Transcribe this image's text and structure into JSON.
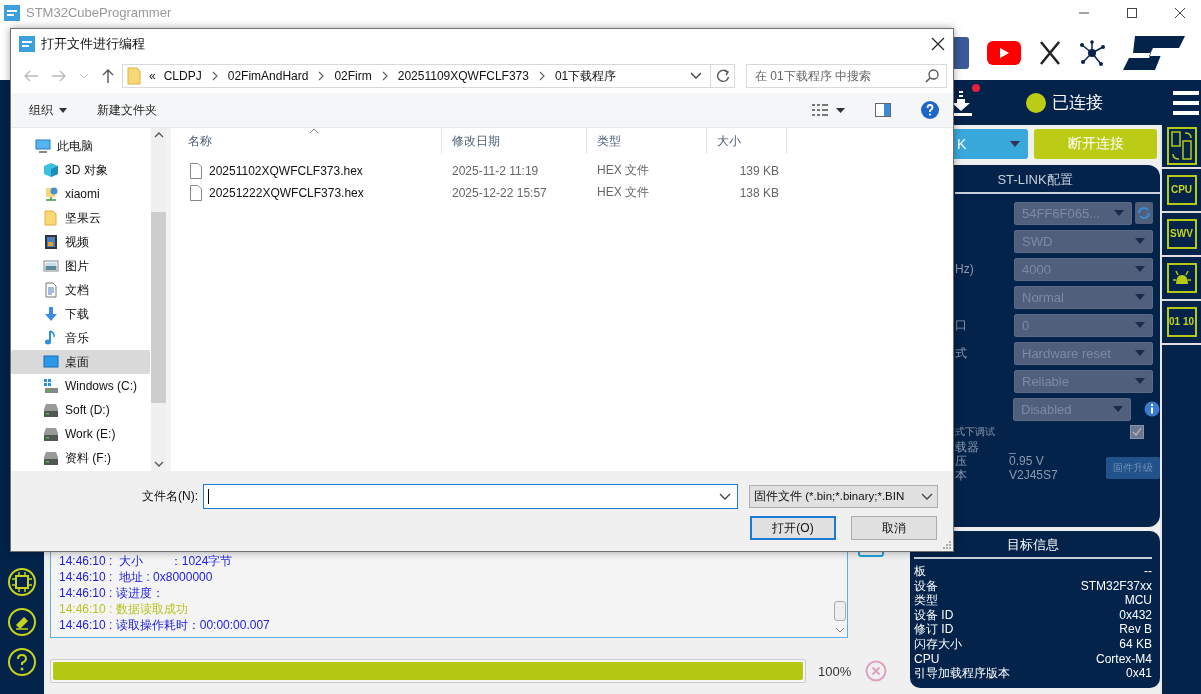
{
  "app": {
    "title": "STM32CubeProgrammer"
  },
  "status": {
    "label": "已连接",
    "connected": true,
    "notification": true
  },
  "connection": {
    "interface": "K",
    "disconnect": "断开连接"
  },
  "stlink_config": {
    "title": "ST-LINK配置",
    "fields": [
      {
        "kind": "select",
        "value": "54FF6F065...",
        "disabled": true,
        "refresh": true
      },
      {
        "kind": "select",
        "value": "SWD",
        "disabled": true
      },
      {
        "kind": "select",
        "label": "Hz)",
        "value": "4000",
        "disabled": true
      },
      {
        "kind": "select",
        "value": "Normal",
        "disabled": true
      },
      {
        "kind": "select",
        "label": "口",
        "value": "0",
        "disabled": true
      },
      {
        "kind": "select",
        "label": "式",
        "value": "Hardware reset",
        "disabled": true
      },
      {
        "kind": "select",
        "value": "Reliable",
        "disabled": true
      },
      {
        "kind": "select",
        "value": "Disabled",
        "disabled": true,
        "info": true
      },
      {
        "kind": "checkbox",
        "label": "式下调试",
        "checked": true,
        "disabled": true
      },
      {
        "kind": "info",
        "label": "载器",
        "value": "_"
      },
      {
        "kind": "info",
        "label": "压",
        "value": "0.95 V"
      },
      {
        "kind": "info",
        "label": "本",
        "value": "V2J45S7"
      }
    ],
    "firmware_button": {
      "label": "固件升级",
      "disabled": true
    }
  },
  "tools": [
    {
      "kind": "files"
    },
    {
      "kind": "text",
      "label": "CPU"
    },
    {
      "kind": "text",
      "label": "SWV"
    },
    {
      "kind": "bug"
    },
    {
      "kind": "text",
      "label": "01 10"
    }
  ],
  "log": [
    {
      "kind": "info",
      "text": "14:46:10 :  大小        ：1024字节"
    },
    {
      "kind": "info",
      "text": "14:46:10 :  地址 : 0x8000000"
    },
    {
      "kind": "info",
      "text": "14:46:10 : 读进度："
    },
    {
      "kind": "success",
      "text": "14:46:10 : 数据读取成功"
    },
    {
      "kind": "info",
      "text": "14:46:10 : 读取操作耗时：00:00:00.007"
    }
  ],
  "progress": {
    "level": 1,
    "reading": "100%"
  },
  "target_info": {
    "title": "目标信息",
    "rows": [
      {
        "label": "板",
        "value": "--"
      },
      {
        "label": "设备",
        "value": "STM32F37xx"
      },
      {
        "label": "类型",
        "value": "MCU"
      },
      {
        "label": "设备 ID",
        "value": "0x432"
      },
      {
        "label": "修订 ID",
        "value": "Rev B"
      },
      {
        "label": "闪存大小",
        "value": "64 KB"
      },
      {
        "label": "CPU",
        "value": "Cortex-M4"
      },
      {
        "label": "引导加载程序版本",
        "value": "0x41"
      }
    ]
  },
  "dialog": {
    "title": "打开文件进行编程",
    "overflow_mark": "«",
    "path": [
      "CLDPJ",
      "02FimAndHard",
      "02Firm",
      "20251109XQWFCLF373",
      "01下载程序"
    ],
    "search": {
      "placeholder": "在 01下载程序 中搜索"
    },
    "toolbar": {
      "organize": "组织",
      "new_folder": "新建文件夹"
    },
    "nav": [
      {
        "label": "此电脑",
        "kind": "computer",
        "selected": false,
        "children": [
          {
            "label": "3D 对象",
            "kind": "cube",
            "selected": false
          },
          {
            "label": "xiaomi",
            "kind": "network",
            "selected": false
          },
          {
            "label": "坚果云",
            "kind": "folder",
            "selected": false
          },
          {
            "label": "视频",
            "kind": "video",
            "selected": false
          },
          {
            "label": "图片",
            "kind": "pictures",
            "selected": false
          },
          {
            "label": "文档",
            "kind": "documents",
            "selected": false
          },
          {
            "label": "下载",
            "kind": "downloads",
            "selected": false
          },
          {
            "label": "音乐",
            "kind": "music",
            "selected": false
          },
          {
            "label": "桌面",
            "kind": "desktop",
            "selected": true
          },
          {
            "label": "Windows (C:)",
            "kind": "system_drive",
            "selected": false
          },
          {
            "label": "Soft (D:)",
            "kind": "drive",
            "selected": false
          },
          {
            "label": "Work (E:)",
            "kind": "drive",
            "selected": false
          },
          {
            "label": "资料 (F:)",
            "kind": "drive",
            "selected": false
          }
        ]
      }
    ],
    "columns": [
      "名称",
      "修改日期",
      "类型",
      "大小"
    ],
    "files": [
      {
        "name": "20251102XQWFCLF373.hex",
        "modified": "2025-11-2 11:19",
        "type": "HEX 文件",
        "size": "139 KB",
        "selected": false
      },
      {
        "name": "20251222XQWFCLF373.hex",
        "modified": "2025-12-22 15:57",
        "type": "HEX 文件",
        "size": "138 KB",
        "selected": false
      }
    ],
    "file_name": {
      "label": "文件名(N):"
    },
    "filter": "固件文件 (*.bin;*.binary;*.BIN",
    "buttons": [
      {
        "label": "打开(O)",
        "default": true
      },
      {
        "label": "取消",
        "default": false
      }
    ]
  }
}
